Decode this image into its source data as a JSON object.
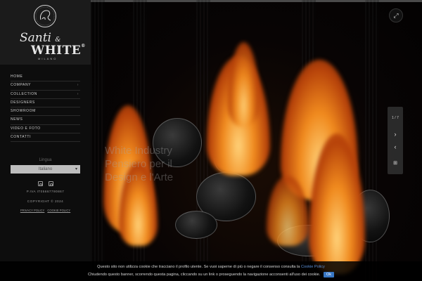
{
  "brand": {
    "script_name": "Santi",
    "ampersand": "&",
    "name": "WHITE",
    "registered": "®",
    "city": "MILANO"
  },
  "nav": {
    "items": [
      {
        "label": "HOME",
        "has_caret": false
      },
      {
        "label": "COMPANY",
        "has_caret": true
      },
      {
        "label": "COLLECTION",
        "has_caret": true
      },
      {
        "label": "DESIGNERS",
        "has_caret": false
      },
      {
        "label": "SHOWROOM",
        "has_caret": false
      },
      {
        "label": "NEWS",
        "has_caret": false
      },
      {
        "label": "VIDEO E FOTO",
        "has_caret": false
      },
      {
        "label": "CONTATTI",
        "has_caret": false
      }
    ],
    "caret_glyph": "›"
  },
  "language": {
    "label": "Lingua",
    "selected": "Italiano",
    "arrow_glyph": "▾"
  },
  "social": {
    "icons": [
      "instagram-icon",
      "instagram-icon"
    ]
  },
  "footer": {
    "piva": "P.IVA IT05667790867",
    "copyright": "COPYRIGHT © 2024",
    "privacy_policy": "PRIVACY POLICY",
    "cookie_policy": "COOKIE POLICY"
  },
  "hero": {
    "headline": "White Industry Pensiero per il Design e l'Arte",
    "slide_counter": "1 / 7",
    "next_glyph": "›",
    "prev_glyph": "‹",
    "grid_glyph": "⊞",
    "expand_glyph": "⤢"
  },
  "cookie_bar": {
    "line1": "Questo sito non utilizza cookie che tracciano il profilo utente. Se vuoi saperne di più o negare il consenso consulta la",
    "link": "Cookie Policy",
    "line2": "Chiudendo questo banner, scorrendo questa pagina, cliccando su un link o proseguendo la navigazione acconsenti all'uso dei cookie.",
    "ok_label": "Ok",
    "link_color": "#5b8fd6",
    "ok_color": "#3877c4"
  }
}
